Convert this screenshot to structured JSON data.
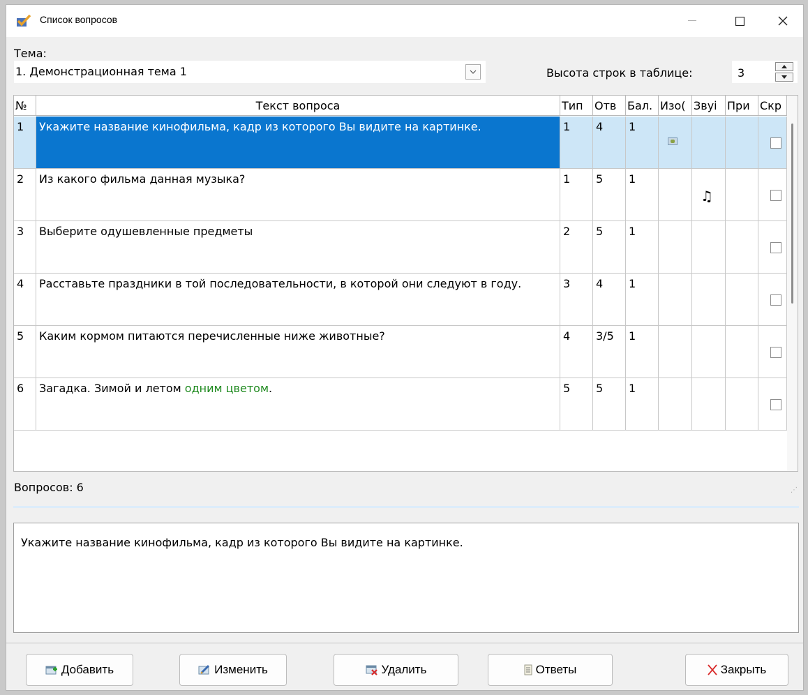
{
  "window": {
    "title": "Список вопросов"
  },
  "theme": {
    "label": "Тема:",
    "value": "1. Демонстрационная тема 1"
  },
  "row_height": {
    "label": "Высота строк в таблице:",
    "value": "3"
  },
  "table": {
    "headers": [
      "№",
      "Текст вопроса",
      "Тип",
      "Отв",
      "Бал.",
      "Изо(",
      "Звуі",
      "При",
      "Скр"
    ],
    "rows": [
      {
        "num": "1",
        "text": "Укажите название кинофильма, кадр из которого Вы видите на картинке.",
        "text_green": "",
        "type": "1",
        "answers": "4",
        "score": "1",
        "has_image": true,
        "has_sound": false,
        "selected": true
      },
      {
        "num": "2",
        "text": "Из какого фильма данная музыка?",
        "text_green": "",
        "type": "1",
        "answers": "5",
        "score": "1",
        "has_image": false,
        "has_sound": true,
        "selected": false
      },
      {
        "num": "3",
        "text": "Выберите одушевленные предметы",
        "text_green": "",
        "type": "2",
        "answers": "5",
        "score": "1",
        "has_image": false,
        "has_sound": false,
        "selected": false
      },
      {
        "num": "4",
        "text": "Расставьте праздники в той последовательности, в которой они следуют в году.",
        "text_green": "",
        "type": "3",
        "answers": "4",
        "score": "1",
        "has_image": false,
        "has_sound": false,
        "selected": false
      },
      {
        "num": "5",
        "text": "Каким кормом питаются перечисленные ниже животные?",
        "text_green": "",
        "type": "4",
        "answers": "3/5",
        "score": "1",
        "has_image": false,
        "has_sound": false,
        "selected": false
      },
      {
        "num": "6",
        "text": "Загадка. Зимой и летом ",
        "text_green": "одним цветом",
        "text_after": ".",
        "type": "5",
        "answers": "5",
        "score": "1",
        "has_image": false,
        "has_sound": false,
        "selected": false
      }
    ]
  },
  "status": {
    "count": "Вопросов: 6"
  },
  "preview": {
    "text": "Укажите название кинофильма, кадр из которого Вы видите на картинке."
  },
  "buttons": {
    "add": "Добавить",
    "edit": "Изменить",
    "delete": "Удалить",
    "answers": "Ответы",
    "close": "Закрыть"
  },
  "colors": {
    "selection": "#0a76cf",
    "selection_row": "#cde6f7",
    "highlight_text": "#1f8a1f"
  },
  "icons": {
    "app": "checkmark-app-icon",
    "image": "image-icon",
    "sound": "music-note-icon"
  }
}
